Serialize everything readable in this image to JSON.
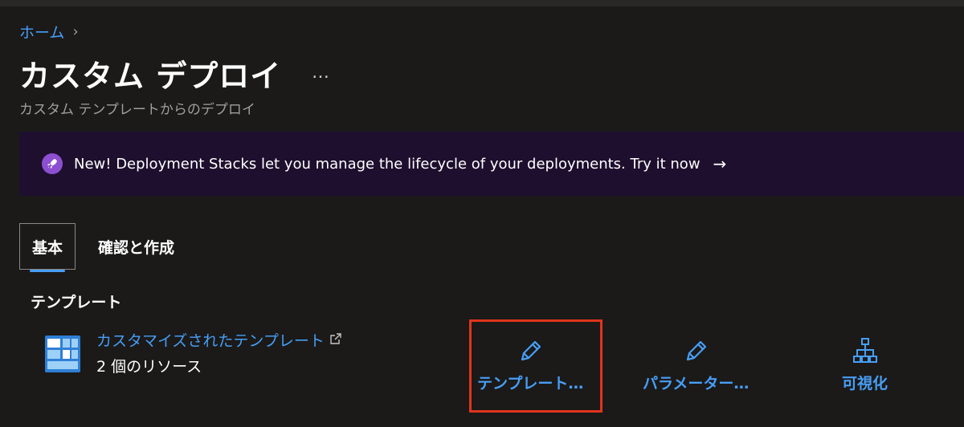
{
  "breadcrumb": {
    "home": "ホーム",
    "separator": "›"
  },
  "page": {
    "title": "カスタム デプロイ",
    "more": "…",
    "subtitle": "カスタム テンプレートからのデプロイ"
  },
  "banner": {
    "icon": "rocket-icon",
    "text": "New! Deployment Stacks let you manage the lifecycle of your deployments. Try it now",
    "arrow": "→"
  },
  "tabs": [
    {
      "label": "基本",
      "active": true
    },
    {
      "label": "確認と作成",
      "active": false
    }
  ],
  "template": {
    "section_title": "テンプレート",
    "link_label": "カスタマイズされたテンプレート",
    "resource_count": "2 個のリソース"
  },
  "actions": [
    {
      "label": "テンプレート…",
      "icon": "pencil-icon"
    },
    {
      "label": "パラメーター…",
      "icon": "pencil-icon"
    },
    {
      "label": "可視化",
      "icon": "hierarchy-icon"
    }
  ],
  "colors": {
    "accent": "#479ef5",
    "background": "#1b1a19",
    "banner_bg": "#1e0f2e",
    "highlight": "#e0341c"
  }
}
